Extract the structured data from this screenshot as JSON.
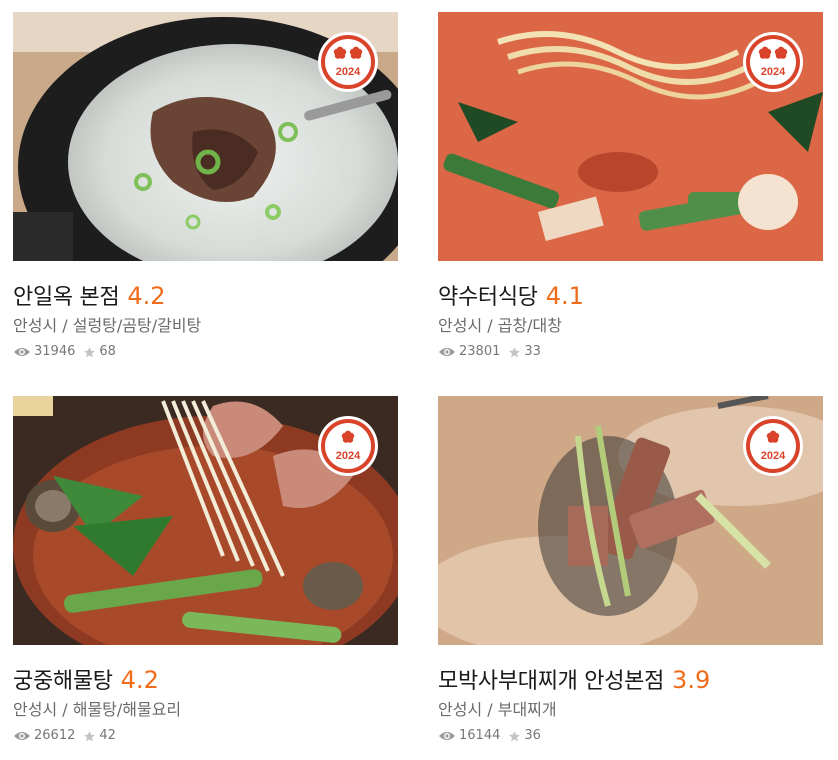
{
  "restaurants": [
    {
      "name": "안일옥 본점",
      "rating": "4.2",
      "category": "안성시 / 설렁탕/곰탕/갈비탕",
      "views": "31946",
      "stars": "68",
      "badge": {
        "year": "2024",
        "marks": 2
      },
      "photo_desc": "soup-in-black-pot-icon"
    },
    {
      "name": "약수터식당",
      "rating": "4.1",
      "category": "안성시 / 곱창/대창",
      "views": "23801",
      "stars": "33",
      "badge": {
        "year": "2024",
        "marks": 2
      },
      "photo_desc": "spicy-stew-noodles-icon"
    },
    {
      "name": "궁중해물탕",
      "rating": "4.2",
      "category": "안성시 / 해물탕/해물요리",
      "views": "26612",
      "stars": "42",
      "badge": {
        "year": "2024",
        "marks": 1
      },
      "photo_desc": "seafood-hotpot-icon"
    },
    {
      "name": "모박사부대찌개 안성본점",
      "rating": "3.9",
      "category": "안성시 / 부대찌개",
      "views": "16144",
      "stars": "36",
      "badge": {
        "year": "2024",
        "marks": 1
      },
      "photo_desc": "budae-jjigae-ladle-icon"
    }
  ],
  "colors": {
    "rating": "#ef6c1a",
    "badge_red": "#d9432a",
    "name": "#1a1a1a",
    "meta": "#6b6b6b"
  }
}
